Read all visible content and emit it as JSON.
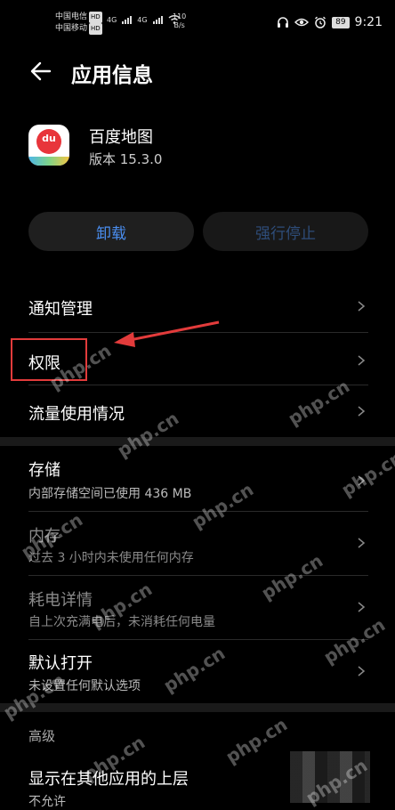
{
  "status_bar": {
    "carrier1": "中国电信",
    "carrier2": "中国移动",
    "hd": "HD",
    "net1": "4G",
    "net2": "4G",
    "speed_value": "110",
    "speed_unit": "B/s",
    "battery": "89",
    "time": "9:21"
  },
  "header": {
    "title": "应用信息"
  },
  "app": {
    "name": "百度地图",
    "version": "版本 15.3.0",
    "icon_label": "du"
  },
  "buttons": {
    "uninstall": "卸载",
    "force_stop": "强行停止"
  },
  "items": [
    {
      "label": "通知管理"
    },
    {
      "label": "权限"
    },
    {
      "label": "流量使用情况"
    },
    {
      "label": "存储",
      "sub": "内部存储空间已使用 436 MB"
    },
    {
      "label": "内存",
      "sub": "过去 3 小时内未使用任何内存"
    },
    {
      "label": "耗电详情",
      "sub": "自上次充满电后，未消耗任何电量"
    },
    {
      "label": "默认打开",
      "sub": "未设置任何默认选项"
    }
  ],
  "advanced": {
    "header": "高级",
    "item_label": "显示在其他应用的上层",
    "item_sub": "不允许"
  },
  "watermark": "php.cn",
  "colors": {
    "accent": "#4a8ef0",
    "annotation": "#e23b3b"
  }
}
